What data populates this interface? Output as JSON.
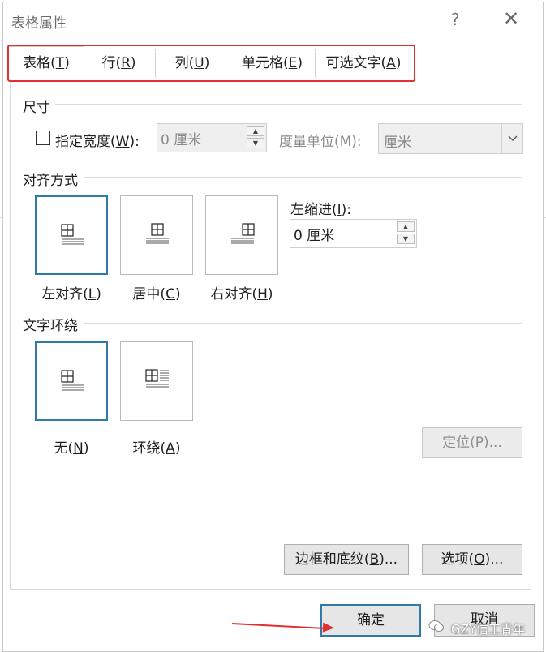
{
  "dialog": {
    "title": "表格属性",
    "help": "?",
    "close": "✕"
  },
  "tabs": [
    {
      "label": "表格(",
      "key": "T",
      "suffix": ")",
      "active": true
    },
    {
      "label": "行(",
      "key": "R",
      "suffix": ")",
      "active": false
    },
    {
      "label": "列(",
      "key": "U",
      "suffix": ")",
      "active": false
    },
    {
      "label": "单元格(",
      "key": "E",
      "suffix": ")",
      "active": false
    },
    {
      "label": "可选文字(",
      "key": "A",
      "suffix": ")",
      "active": false
    }
  ],
  "size": {
    "title": "尺寸",
    "preferred_width_label_pre": "指定宽度(",
    "preferred_width_key": "W",
    "preferred_width_label_post": "):",
    "preferred_width_checked": false,
    "width_value": "0 厘米",
    "unit_label": "度量单位(M):",
    "unit_value": "厘米"
  },
  "alignment": {
    "title": "对齐方式",
    "options": [
      {
        "label": "左对齐(",
        "key": "L",
        "suffix": ")",
        "selected": true
      },
      {
        "label": "居中(",
        "key": "C",
        "suffix": ")",
        "selected": false
      },
      {
        "label": "右对齐(",
        "key": "H",
        "suffix": ")",
        "selected": false
      }
    ],
    "indent_label_pre": "左缩进(",
    "indent_key": "I",
    "indent_label_post": "):",
    "indent_value": "0 厘米"
  },
  "wrapping": {
    "title": "文字环绕",
    "options": [
      {
        "label": "无(",
        "key": "N",
        "suffix": ")",
        "selected": true
      },
      {
        "label": "环绕(",
        "key": "A",
        "suffix": ")",
        "selected": false
      }
    ],
    "position_button": "定位(P)..."
  },
  "buttons": {
    "borders_pre": "边框和底纹(",
    "borders_key": "B",
    "borders_post": ")...",
    "options_pre": "选项(",
    "options_key": "O",
    "options_post": ")...",
    "ok": "确定",
    "cancel": "取消"
  },
  "watermark": "GZY信工青年",
  "colors": {
    "accent": "#2f7aa6",
    "annotation_red": "#e03030"
  }
}
